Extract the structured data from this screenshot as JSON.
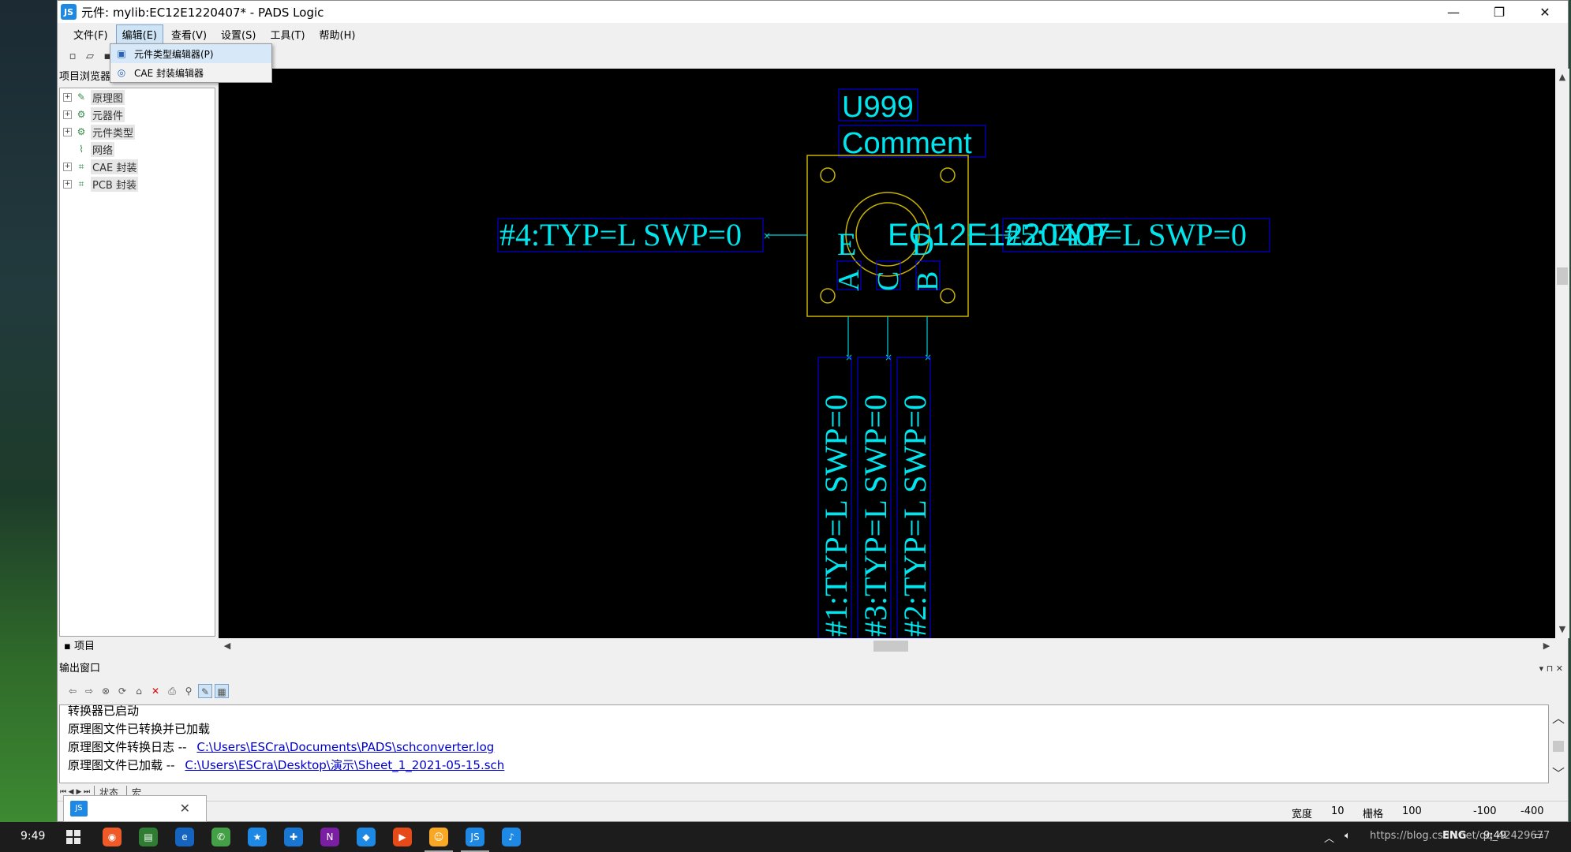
{
  "window": {
    "title": "元件: mylib:EC12E1220407* - PADS Logic",
    "app_icon": "pads-logic-icon",
    "controls": {
      "minimize": "—",
      "restore": "❐",
      "close": "✕"
    }
  },
  "menubar": {
    "items": [
      {
        "label": "文件(F)"
      },
      {
        "label": "编辑(E)",
        "active": true
      },
      {
        "label": "查看(V)"
      },
      {
        "label": "设置(S)"
      },
      {
        "label": "工具(T)"
      },
      {
        "label": "帮助(H)"
      }
    ]
  },
  "dropdown": {
    "items": [
      {
        "label": "元件类型编辑器(P)",
        "icon": "part-type-editor-icon"
      },
      {
        "label": "CAE 封装编辑器",
        "icon": "cae-decal-editor-icon"
      }
    ]
  },
  "project_browser": {
    "title": "项目浏览器",
    "items": [
      {
        "label": "原理图",
        "icon": "schematic-icon",
        "expandable": true
      },
      {
        "label": "元器件",
        "icon": "components-icon",
        "expandable": true
      },
      {
        "label": "元件类型",
        "icon": "part-types-icon",
        "expandable": true
      },
      {
        "label": "网络",
        "icon": "nets-icon",
        "expandable": false
      },
      {
        "label": "CAE 封装",
        "icon": "cae-decals-icon",
        "expandable": true
      },
      {
        "label": "PCB 封装",
        "icon": "pcb-decals-icon",
        "expandable": true
      }
    ],
    "tab_label": "项目"
  },
  "schematic": {
    "ref_des": "U999",
    "comment": "Comment",
    "part_name": "EC12E1220407",
    "pin_labels": {
      "pin4": "#4:TYP=L SWP=0",
      "pin5": "#5:TYP=L SWP=0",
      "pin1": "#1:TYP=L SWP=0",
      "pin3": "#3:TYP=L SWP=0",
      "pin2": "#2:TYP=L SWP=0"
    },
    "pin_names": {
      "e_left": "E",
      "d_right": "D",
      "a": "A",
      "c": "C",
      "b": "B"
    },
    "colors": {
      "background": "#000000",
      "text": "#00e5ee",
      "body": "#c8b400",
      "box": "#0000ff"
    }
  },
  "output_window": {
    "title": "输出窗口",
    "lines": [
      {
        "text": "转换器已启动",
        "link": ""
      },
      {
        "text": "原理图文件已转换并已加载",
        "link": ""
      },
      {
        "text": "原理图文件转换日志  --",
        "link": "C:\\Users\\ESCra\\Documents\\PADS\\schconverter.log"
      },
      {
        "text": "原理图文件已加载  --",
        "link": "C:\\Users\\ESCra\\Desktop\\演示\\Sheet_1_2021-05-15.sch"
      }
    ],
    "tabs": [
      "状态",
      "宏"
    ]
  },
  "statusbar": {
    "width_label": "宽度",
    "width_value": "10",
    "grid_label": "栅格",
    "grid_value": "100",
    "x": "-100",
    "y": "-400"
  },
  "taskbar": {
    "clock_left": "9:49",
    "lang": "ENG",
    "clock_right": "9:49",
    "watermark": "https://blog.csdn.net/qq_42429677"
  }
}
